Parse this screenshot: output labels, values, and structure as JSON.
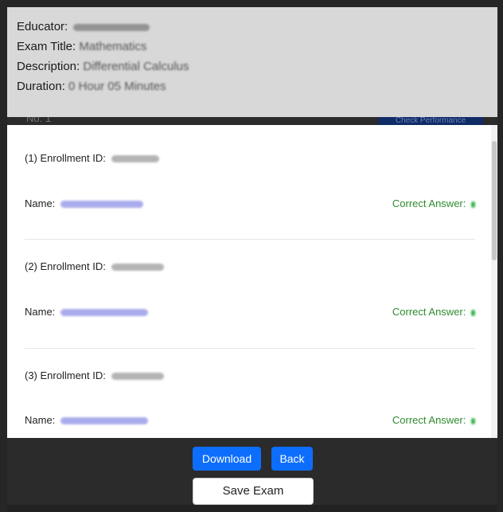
{
  "header": {
    "educator_label": "Educator:",
    "exam_title_label": "Exam Title:",
    "exam_title_value": "Mathematics",
    "description_label": "Description:",
    "description_value": "Differential Calculus",
    "duration_label": "Duration:",
    "duration_value": "0 Hour 05 Minutes"
  },
  "background": {
    "no_label": "No. 1",
    "check_performance": "Check Performance"
  },
  "students": [
    {
      "enroll_label": "(1) Enrollment ID:",
      "name_label": "Name:",
      "correct_label": "Correct Answer:"
    },
    {
      "enroll_label": "(2) Enrollment ID:",
      "name_label": "Name:",
      "correct_label": "Correct Answer:"
    },
    {
      "enroll_label": "(3) Enrollment ID:",
      "name_label": "Name:",
      "correct_label": "Correct Answer:"
    }
  ],
  "actions": {
    "download": "Download",
    "back": "Back",
    "save_exam": "Save Exam"
  }
}
